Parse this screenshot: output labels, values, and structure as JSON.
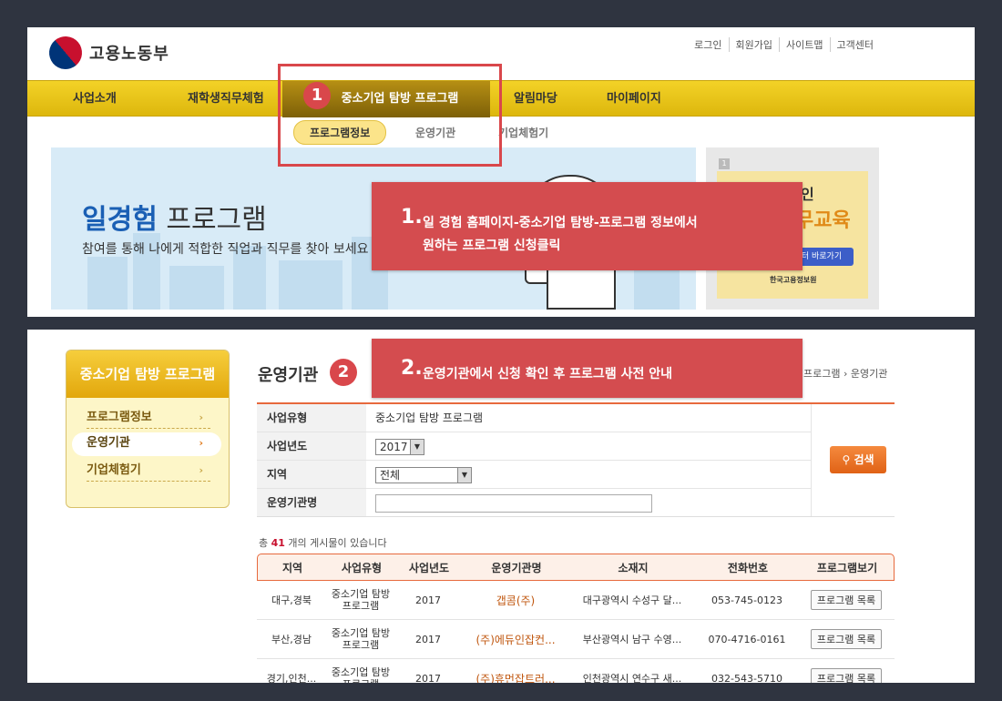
{
  "header": {
    "logo_text": "고용노동부",
    "top_links": [
      "로그인",
      "회원가입",
      "사이트맵",
      "고객센터"
    ],
    "menu": [
      "사업소개",
      "재학생직무체험",
      "중소기업 탐방 프로그램",
      "알림마당",
      "마이페이지"
    ],
    "submenu": [
      "프로그램정보",
      "운영기관",
      "기업체험기"
    ]
  },
  "banner": {
    "title_bold": "일경험",
    "title_rest": " 프로그램",
    "desc": "참여를 통해 나에게 적합한 직업과 직무를 찾아 보세요"
  },
  "side_banner": {
    "tag": "1",
    "line1": "인",
    "line2": "무교육",
    "button": "터 바로가기",
    "logo": "한국고용정보원"
  },
  "callouts": [
    {
      "num": "1",
      "lines": [
        "일 경험 홈페이지-중소기업 탐방-프로그램 정보에서",
        "원하는 프로그램 신청클릭"
      ]
    },
    {
      "num": "2",
      "lines": [
        "운영기관에서 신청 확인 후 프로그램 사전 안내"
      ]
    }
  ],
  "badges": [
    "1",
    "2"
  ],
  "lnb": {
    "title": "중소기업 탐방 프로그램",
    "items": [
      "프로그램정보",
      "운영기관",
      "기업체험기"
    ],
    "arrow": "›"
  },
  "page": {
    "title": "운영기관",
    "breadcrumb": "프로그램 › 운영기관"
  },
  "search": {
    "labels": [
      "사업유형",
      "사업년도",
      "지역",
      "운영기관명"
    ],
    "type_value": "중소기업 탐방 프로그램",
    "year": "2017",
    "region": "전체",
    "name_value": "",
    "button": "검색"
  },
  "count": {
    "prefix": "총 ",
    "num": "41",
    "suffix": " 개의 게시물이 있습니다"
  },
  "table": {
    "headers": [
      "지역",
      "사업유형",
      "사업년도",
      "운영기관명",
      "소재지",
      "전화번호",
      "프로그램보기"
    ],
    "rows": [
      [
        "대구,경북",
        "중소기업 탐방 프로그램",
        "2017",
        "갭콤(주)",
        "대구광역시 수성구 달...",
        "053-745-0123",
        "프로그램 목록"
      ],
      [
        "부산,경남",
        "중소기업 탐방 프로그램",
        "2017",
        "(주)에듀인잡컨...",
        "부산광역시 남구 수영...",
        "070-4716-0161",
        "프로그램 목록"
      ],
      [
        "경기,인천...",
        "중소기업 탐방 프로그램",
        "2017",
        "(주)휴먼잡트러...",
        "인천광역시 연수구 새...",
        "032-543-5710",
        "프로그램 목록"
      ]
    ]
  },
  "colors": {
    "accent": "#d9474b",
    "menu": "#eccb1e",
    "orange": "#e7693d"
  }
}
